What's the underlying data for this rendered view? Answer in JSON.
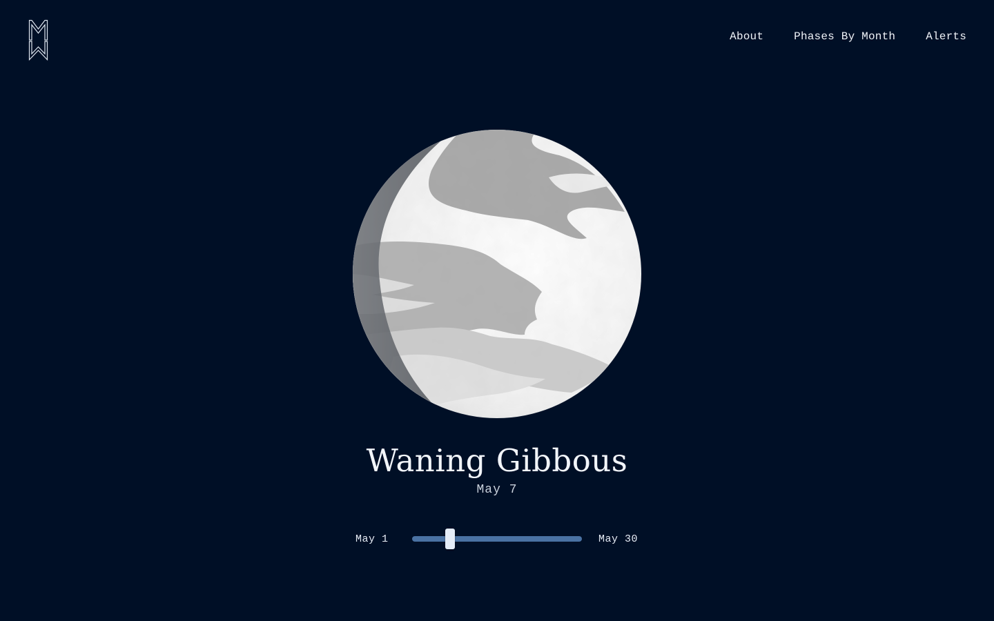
{
  "header": {
    "logo_icon": "mw-monogram-logo",
    "nav": [
      {
        "label": "About"
      },
      {
        "label": "Phases By Month"
      },
      {
        "label": "Alerts"
      }
    ]
  },
  "moon": {
    "phase_name": "Waning Gibbous",
    "date": "May 7",
    "image_icon": "moon-waning-gibbous-illustration"
  },
  "slider": {
    "start_label": "May 1",
    "end_label": "May 30",
    "min_day": 1,
    "max_day": 30,
    "current_day": 7
  },
  "colors": {
    "background": "#000f26",
    "slider_track": "#4a72a3",
    "slider_thumb": "#e4ecf7",
    "text": "#f2f5fa"
  }
}
